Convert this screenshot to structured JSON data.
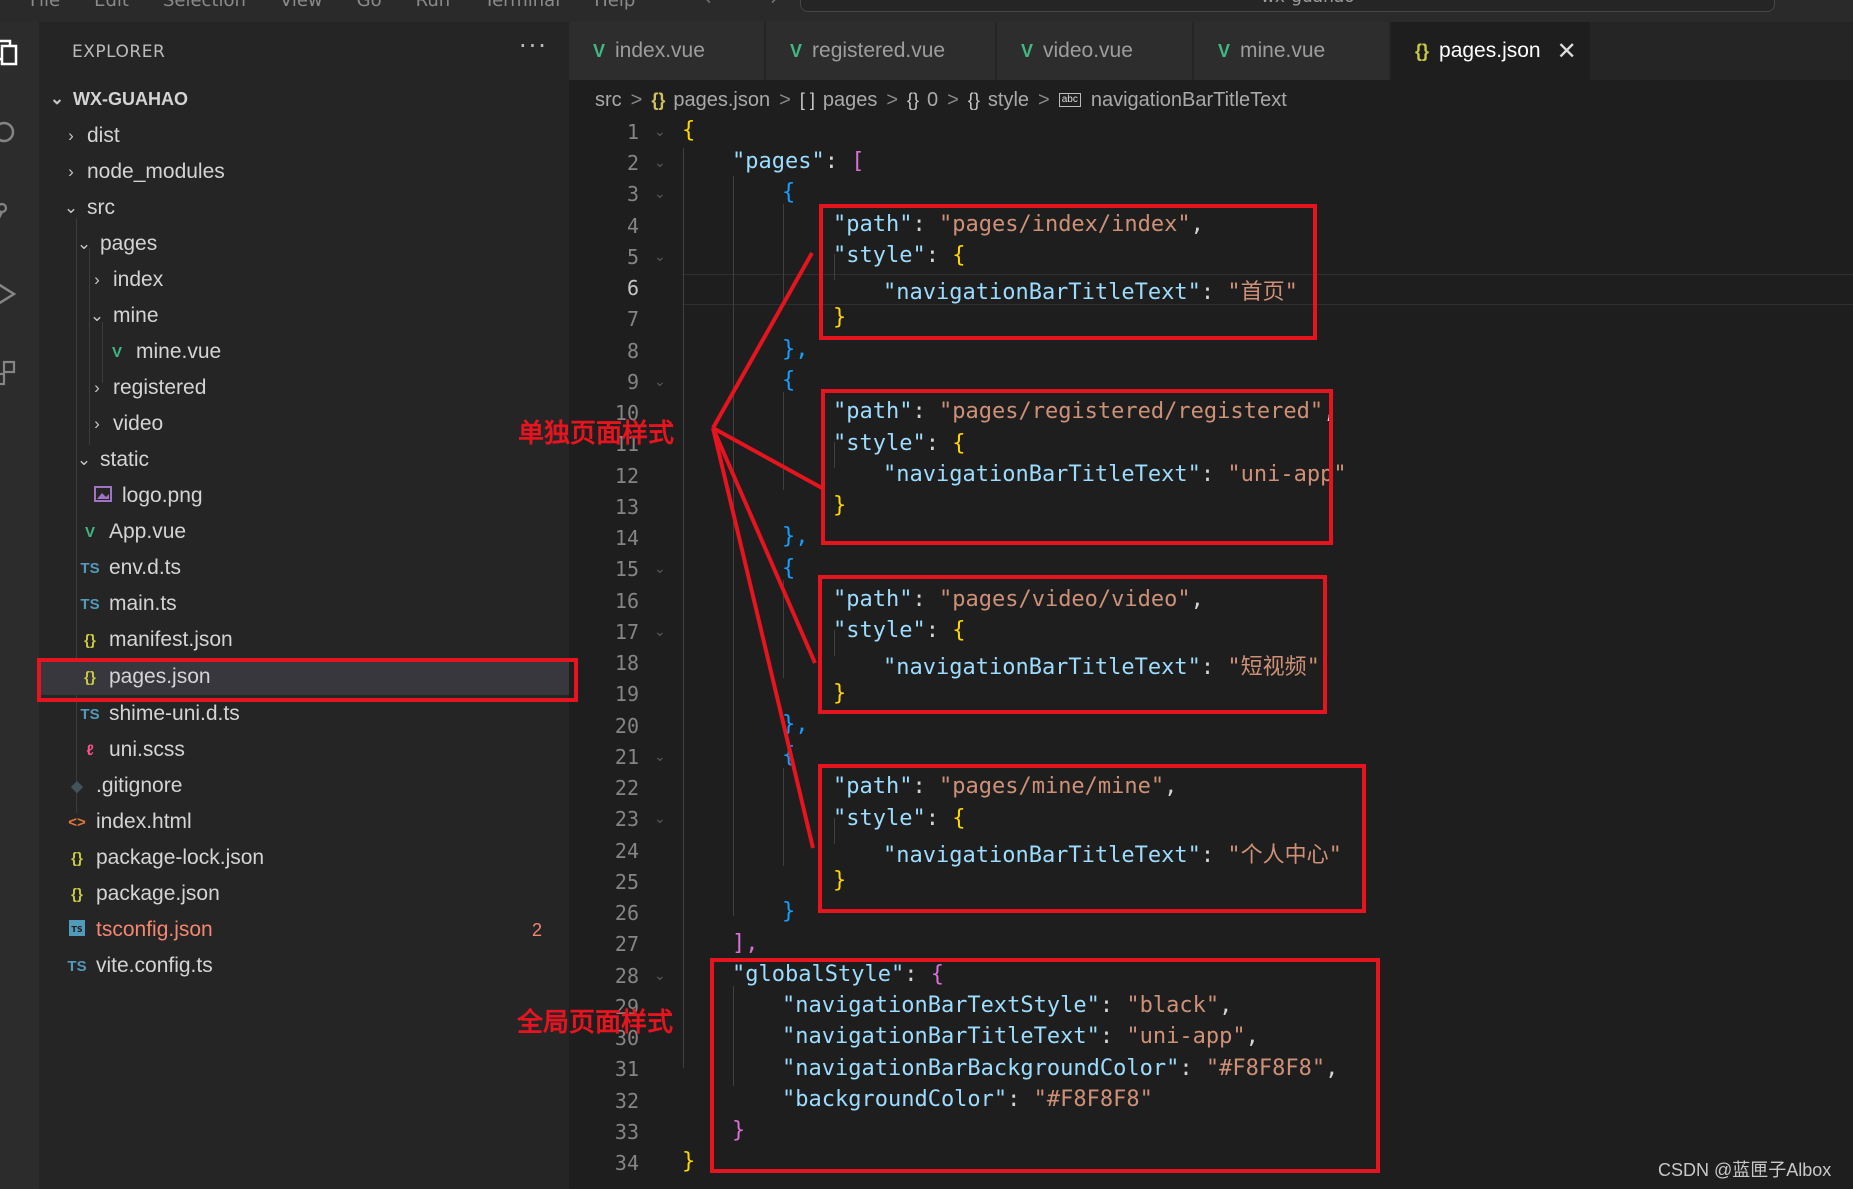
{
  "menubar": {
    "items": [
      "File",
      "Edit",
      "Selection",
      "View",
      "Go",
      "Run",
      "Terminal",
      "Help"
    ],
    "nav_arrows": "← →",
    "command_center_text": "wx-guahao"
  },
  "sidebar": {
    "title": "EXPLORER",
    "more": "···",
    "root": "WX-GUAHAO",
    "items": [
      {
        "label": "dist",
        "chevron": ">"
      },
      {
        "label": "node_modules",
        "chevron": ">"
      },
      {
        "label": "src",
        "chevron": "v"
      },
      {
        "label": "pages",
        "chevron": "v"
      },
      {
        "label": "index",
        "chevron": ">"
      },
      {
        "label": "mine",
        "chevron": "v"
      },
      {
        "label": "mine.vue",
        "icon": "V"
      },
      {
        "label": "registered",
        "chevron": ">"
      },
      {
        "label": "video",
        "chevron": ">"
      },
      {
        "label": "static",
        "chevron": "v"
      },
      {
        "label": "logo.png",
        "icon": "img"
      },
      {
        "label": "App.vue",
        "icon": "V"
      },
      {
        "label": "env.d.ts",
        "icon": "TS"
      },
      {
        "label": "main.ts",
        "icon": "TS"
      },
      {
        "label": "manifest.json",
        "icon": "{}"
      },
      {
        "label": "pages.json",
        "icon": "{}"
      },
      {
        "label": "shime-uni.d.ts",
        "icon": "TS"
      },
      {
        "label": "uni.scss",
        "icon": "scss"
      },
      {
        "label": ".gitignore",
        "icon": "git"
      },
      {
        "label": "index.html",
        "icon": "<>"
      },
      {
        "label": "package-lock.json",
        "icon": "{}"
      },
      {
        "label": "package.json",
        "icon": "{}"
      },
      {
        "label": "tsconfig.json",
        "icon": "TS",
        "badge": "2"
      },
      {
        "label": "vite.config.ts",
        "icon": "TS"
      }
    ]
  },
  "tabs": [
    {
      "label": "index.vue",
      "icon": "V"
    },
    {
      "label": "registered.vue",
      "icon": "V"
    },
    {
      "label": "video.vue",
      "icon": "V"
    },
    {
      "label": "mine.vue",
      "icon": "V"
    },
    {
      "label": "pages.json",
      "icon": "{}",
      "close": "✕"
    }
  ],
  "breadcrumb": {
    "items": [
      "src",
      "pages.json",
      "pages",
      "0",
      "style",
      "navigationBarTitleText"
    ],
    "icons": [
      "{}",
      "[ ]",
      "{}",
      "{}",
      "abc"
    ],
    "separator": ">"
  },
  "editor": {
    "current_line": 6,
    "line_numbers": [
      "1",
      "2",
      "3",
      "4",
      "5",
      "6",
      "7",
      "8",
      "9",
      "10",
      "11",
      "12",
      "13",
      "14",
      "15",
      "16",
      "17",
      "18",
      "19",
      "20",
      "21",
      "22",
      "23",
      "24",
      "25",
      "26",
      "27",
      "28",
      "29",
      "30",
      "31",
      "32",
      "33",
      "34"
    ],
    "code": {
      "open": "{",
      "pages_key": "\"pages\"",
      "colon": ": ",
      "bracket_open": "[",
      "obj_open": "{",
      "obj_close": "},",
      "obj_close_last": "}",
      "bracket_close": "],",
      "path_key": "\"path\"",
      "style_key": "\"style\"",
      "title_key": "\"navigationBarTitleText\"",
      "page_paths": [
        "\"pages/index/index\"",
        "\"pages/registered/registered\"",
        "\"pages/video/video\"",
        "\"pages/mine/mine\""
      ],
      "page_titles": [
        "\"首页\"",
        "\"uni-app\"",
        "\"短视频\"",
        "\"个人中心\""
      ],
      "global_key": "\"globalStyle\"",
      "global_entries": [
        {
          "key": "\"navigationBarTextStyle\"",
          "value": "\"black\""
        },
        {
          "key": "\"navigationBarTitleText\"",
          "value": "\"uni-app\""
        },
        {
          "key": "\"navigationBarBackgroundColor\"",
          "value": "\"#F8F8F8\""
        },
        {
          "key": "\"backgroundColor\"",
          "value": "\"#F8F8F8\""
        }
      ],
      "comma": ",",
      "close": "}"
    }
  },
  "annotations": {
    "single_page_style": "单独页面样式",
    "global_page_style": "全局页面样式",
    "color": "#e6141e"
  },
  "watermark": "CSDN @蓝匣子Albox",
  "colors": {
    "editor_bg": "#1e1e1e",
    "sidebar_bg": "#252526",
    "json_key": "#9cdcfe",
    "json_string": "#ce9178",
    "vue_icon": "#41b883",
    "ts_icon": "#519aba",
    "json_icon": "#cbcb41",
    "error_text": "#f48771"
  }
}
